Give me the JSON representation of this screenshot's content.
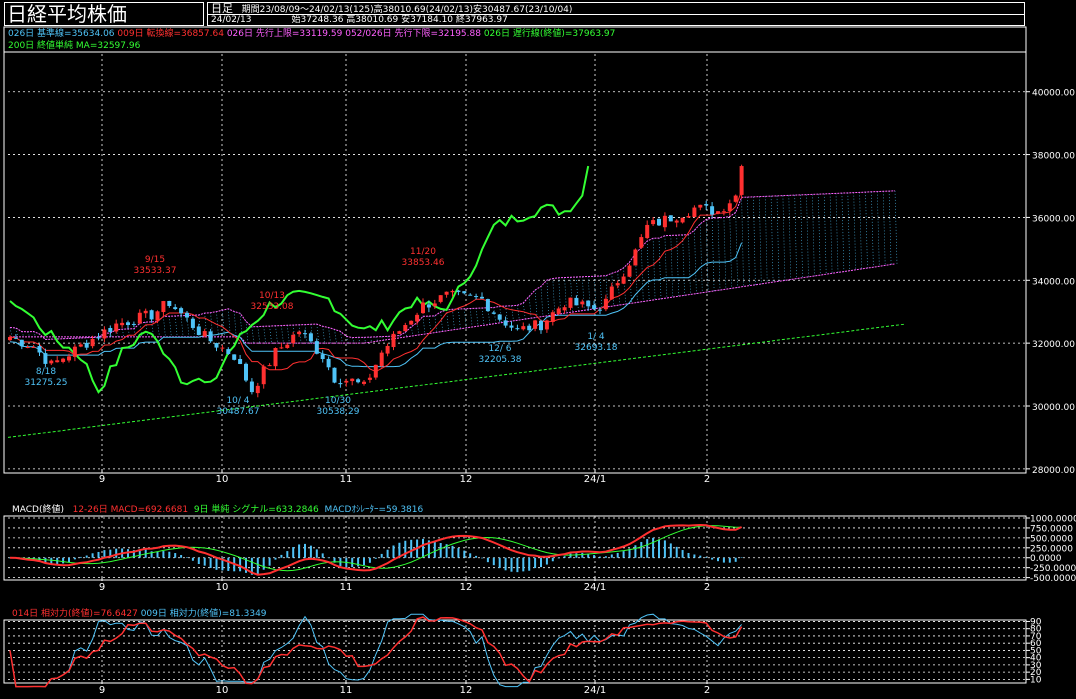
{
  "header": {
    "title": "日経平均株価",
    "period_type": "日足",
    "date": "24/02/13",
    "period": "期間23/08/09～24/02/13(125)高38010.69(24/02/13)安30487.67(23/10/04)",
    "ohlc": "始37248.36 高38010.69 安37184.10 終37963.97"
  },
  "legends": {
    "main1": [
      {
        "text": "026日 基準線=35634.06",
        "color": "#4fc3f7"
      },
      {
        "text": "009日 転換線=36857.64",
        "color": "#ff3030"
      },
      {
        "text": "026日 先行上限=33119.59",
        "color": "#ff60ff"
      },
      {
        "text": "052/026日 先行下限=32195.88",
        "color": "#ff60ff"
      },
      {
        "text": "026日 遅行線(終値)=37963.97",
        "color": "#33ff33"
      }
    ],
    "main2": [
      {
        "text": "200日 終値単純 MA=32597.96",
        "color": "#33ff33"
      }
    ],
    "macd": [
      {
        "text": "MACD(終値)",
        "color": "#ffffff"
      },
      {
        "text": "12-26日 MACD=692.6681",
        "color": "#ff3030"
      },
      {
        "text": "9日 単純 シグナル=633.2846",
        "color": "#33ff33"
      },
      {
        "text": "MACDｵｼﾚｰﾀｰ=59.3816",
        "color": "#4fc3f7"
      }
    ],
    "rsi": [
      {
        "text": "014日 相対力(終値)=76.6427",
        "color": "#ff3030"
      },
      {
        "text": "009日 相対力(終値)=81.3349",
        "color": "#4fc3f7"
      }
    ]
  },
  "chart_data": {
    "type": "candlestick",
    "x_ticks": [
      "9",
      "10",
      "11",
      "12",
      "24/1",
      "2"
    ],
    "price_axis": {
      "ticks": [
        "40000.00",
        "38000.00",
        "36000.00",
        "34000.00",
        "32000.00",
        "30000.00",
        "28000.00"
      ],
      "ylim": [
        27900,
        41200
      ]
    },
    "annotations": [
      {
        "date": "9/15",
        "value": "33533.37",
        "color": "#ff3030",
        "kind": "high"
      },
      {
        "date": "8/18",
        "value": "31275.25",
        "color": "#4fc3f7",
        "kind": "low"
      },
      {
        "date": "10/13",
        "value": "32533.08",
        "color": "#ff3030",
        "kind": "high"
      },
      {
        "date": "10/ 4",
        "value": "30487.67",
        "color": "#4fc3f7",
        "kind": "low"
      },
      {
        "date": "10/30",
        "value": "30538.29",
        "color": "#4fc3f7",
        "kind": "low"
      },
      {
        "date": "11/20",
        "value": "33853.46",
        "color": "#ff3030",
        "kind": "high"
      },
      {
        "date": "12/ 6",
        "value": "32205.38",
        "color": "#4fc3f7",
        "kind": "low"
      },
      {
        "date": "1/ 4",
        "value": "32693.18",
        "color": "#4fc3f7",
        "kind": "low"
      }
    ],
    "macd_axis": {
      "ticks": [
        "1000.0000",
        "750.0000",
        "500.0000",
        "250.0000",
        "0.0000",
        "-250.0000",
        "-500.0000"
      ],
      "ylim": [
        -560,
        1050
      ]
    },
    "rsi_axis": {
      "ticks": [
        "90",
        "80",
        "70",
        "60",
        "50",
        "40",
        "30",
        "20",
        "10"
      ],
      "ylim": [
        5,
        92
      ]
    }
  },
  "colors": {
    "background": "#000000",
    "up": "#ff3030",
    "down": "#4fc3f7",
    "lagging": "#33ff33",
    "cloud": "#ff60ff",
    "grid": "#ffffff"
  }
}
